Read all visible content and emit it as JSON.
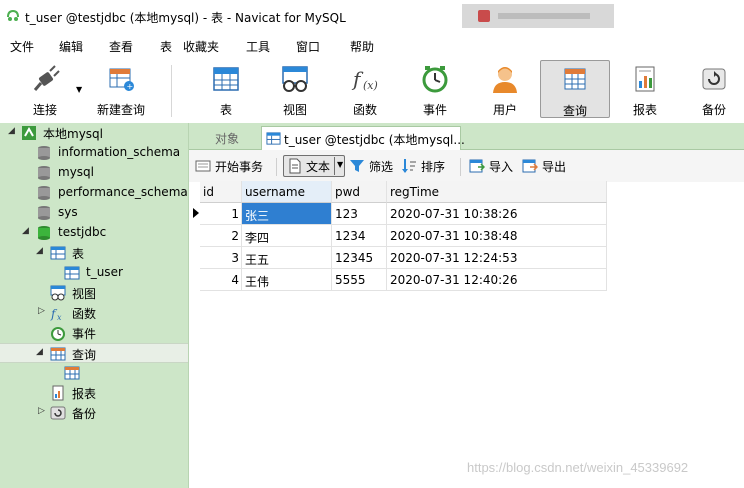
{
  "window": {
    "title": "t_user @testjdbc (本地mysql) - 表 - Navicat for MySQL"
  },
  "menu": [
    "文件",
    "编辑",
    "查看",
    "表",
    "收藏夹",
    "工具",
    "窗口",
    "帮助"
  ],
  "toolbar": {
    "connect": "连接",
    "new_query": "新建查询",
    "table": "表",
    "view": "视图",
    "function": "函数",
    "event": "事件",
    "user": "用户",
    "query": "查询",
    "report": "报表",
    "backup": "备份",
    "active": "查询"
  },
  "tree": {
    "connection": "本地mysql",
    "databases": [
      "information_schema",
      "mysql",
      "performance_schema",
      "sys",
      "testjdbc"
    ],
    "testjdbc_children": {
      "tables": "表",
      "table_item": "t_user",
      "views": "视图",
      "functions": "函数",
      "events": "事件",
      "queries": "查询",
      "reports": "报表",
      "backups": "备份"
    }
  },
  "tabs": {
    "objects": "对象",
    "active_tab": "t_user @testjdbc (本地mysql..."
  },
  "table_toolbar": {
    "begin_transaction": "开始事务",
    "text": "文本",
    "filter": "筛选",
    "sort": "排序",
    "import": "导入",
    "export": "导出"
  },
  "grid": {
    "columns": [
      "id",
      "username",
      "pwd",
      "regTime"
    ],
    "rows": [
      [
        "1",
        "张三",
        "123",
        "2020-07-31 10:38:26"
      ],
      [
        "2",
        "李四",
        "1234",
        "2020-07-31 10:38:48"
      ],
      [
        "3",
        "王五",
        "12345",
        "2020-07-31 12:24:53"
      ],
      [
        "4",
        "王伟",
        "5555",
        "2020-07-31 12:40:26"
      ]
    ],
    "selected_row": 1,
    "selected_column": "username"
  },
  "watermark": "https://blog.csdn.net/weixin_45339692",
  "colors": {
    "sidebar_bg": "#cde6c8",
    "selection": "#2f7fd1"
  }
}
